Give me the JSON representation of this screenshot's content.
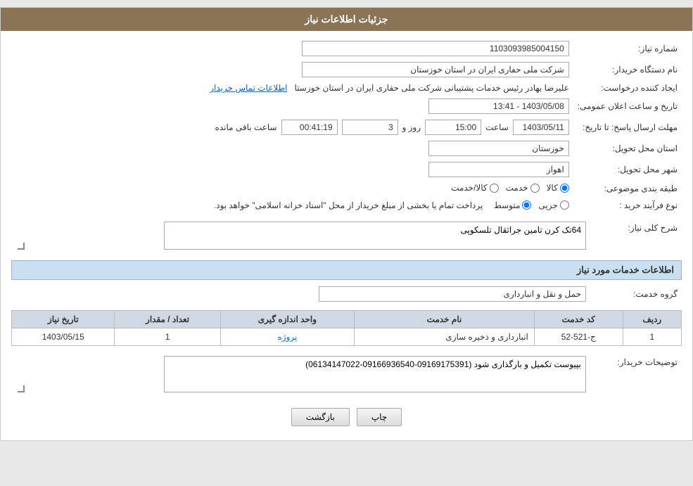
{
  "page": {
    "title": "جزئیات اطلاعات نیاز",
    "header_bg": "#8B7355"
  },
  "fields": {
    "shmare_niaz_label": "شماره نیاز:",
    "shmare_niaz_value": "1103093985004150",
    "name_dastgah_label": "نام دستگاه خریدار:",
    "name_dastgah_value": "شرکت ملی حفاری ایران در استان خوزستان",
    "creator_label": "ایجاد کننده درخواست:",
    "creator_value": "علیرضا بهادر رئیس خدمات پشتیبانی شرکت ملی حفاری ایران در استان خوزستا",
    "contact_link": "اطلاعات تماس خریدار",
    "date_label": "تاریخ و ساعت اعلان عمومی:",
    "date_value": "1403/05/08 - 13:41",
    "mhlat_label": "مهلت ارسال پاسخ: تا تاریخ:",
    "deadline_date": "1403/05/11",
    "deadline_time": "15:00",
    "deadline_days": "3",
    "deadline_remaining": "00:41:19",
    "ostan_label": "استان محل تحویل:",
    "ostan_value": "خوزستان",
    "shahr_label": "شهر محل تحویل:",
    "shahr_value": "اهواز",
    "tabaqe_label": "طبقه بندی موضوعی:",
    "tabaqe_options": [
      "کالا",
      "خدمت",
      "کالا/خدمت"
    ],
    "tabaqe_selected": "کالا",
    "noaa_faraind_label": "نوع فرآیند خرید :",
    "noaa_options": [
      "جزیی",
      "متوسط"
    ],
    "noaa_selected": "متوسط",
    "noaa_description": "پرداخت تمام یا بخشی از مبلغ خریدار از محل \"اسناد خزانه اسلامی\" خواهد بود.",
    "sharh_label": "شرح کلی نیاز:",
    "sharh_value": "64تک کرن تامین جراثقال تلسکوپی",
    "services_header": "اطلاعات خدمات مورد نیاز",
    "group_label": "گروه خدمت:",
    "group_value": "حمل و نقل و انبارداری",
    "table_headers": [
      "ردیف",
      "کد خدمت",
      "نام خدمت",
      "واحد اندازه گیری",
      "تعداد / مقدار",
      "تاریخ نیاز"
    ],
    "table_rows": [
      {
        "row": "1",
        "code": "ج-521-52",
        "name": "انبارداری و ذخیره سازی",
        "unit": "پروژه",
        "count": "1",
        "date": "1403/05/15"
      }
    ],
    "description_label": "توضیحات خریدار:",
    "description_value": "بپیوست تکمیل و بارگذاری شود (09169175391-09166936540-06134147022)",
    "btn_print": "چاپ",
    "btn_back": "بازگشت",
    "saaat_label": "ساعت",
    "rooz_label": "روز و",
    "saaat_baghi_label": "ساعت باقی مانده"
  }
}
